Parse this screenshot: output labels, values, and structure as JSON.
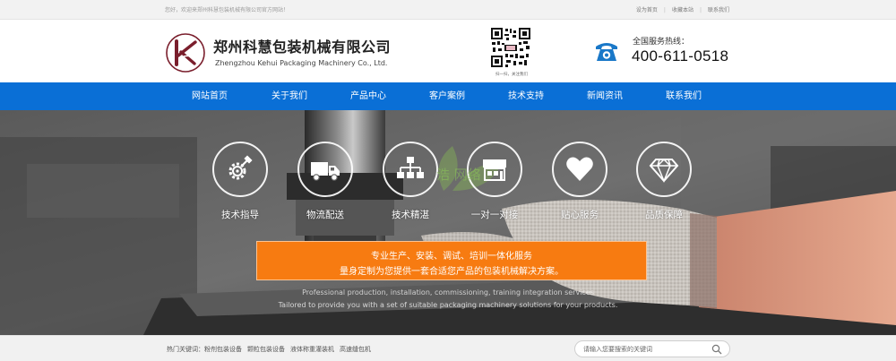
{
  "topbar": {
    "welcome": "您好，欢迎来郑州科慧包装机械有限公司官方网站！",
    "links": [
      "设为首页",
      "收藏本站",
      "联系我们"
    ]
  },
  "header": {
    "company_cn": "郑州科慧包装机械有限公司",
    "company_en": "Zhengzhou Kehui Packaging Machinery Co., Ltd.",
    "qr_caption": "扫一扫，关注我们",
    "hotline_label": "全国服务热线：",
    "hotline_number": "400-611-0518"
  },
  "nav": [
    "网站首页",
    "关于我们",
    "产品中心",
    "客户案例",
    "技术支持",
    "新闻资讯",
    "联系我们"
  ],
  "hero": {
    "features": [
      {
        "label": "技术指导",
        "icon": "gear-wrench-icon"
      },
      {
        "label": "物流配送",
        "icon": "truck-icon"
      },
      {
        "label": "技术精湛",
        "icon": "org-chart-icon"
      },
      {
        "label": "一对一对接",
        "icon": "storefront-icon"
      },
      {
        "label": "贴心服务",
        "icon": "heart-icon"
      },
      {
        "label": "品质保障",
        "icon": "diamond-icon"
      }
    ],
    "banner_line1": "专业生产、安装、调试、培训一体化服务",
    "banner_line2": "量身定制为您提供一套合适您产品的包装机械解决方案。",
    "english_line1": "Professional production, installation, commissioning, training integration services",
    "english_line2": "Tailored to provide you with a set of suitable packaging machinery solutions for your products.",
    "watermark": "浩 网络"
  },
  "bottombar": {
    "hot_label": "热门关键词：",
    "keywords": [
      "粉剂包装设备",
      "颗粒包装设备",
      "液体称重灌装机",
      "高速缝包机"
    ],
    "search_placeholder": "请输入您要搜索的关键词"
  },
  "colors": {
    "nav_blue": "#0a6fd6",
    "banner_orange": "#f77b11",
    "phone_blue": "#1a78c8",
    "logo_maroon": "#7a1e2c"
  }
}
